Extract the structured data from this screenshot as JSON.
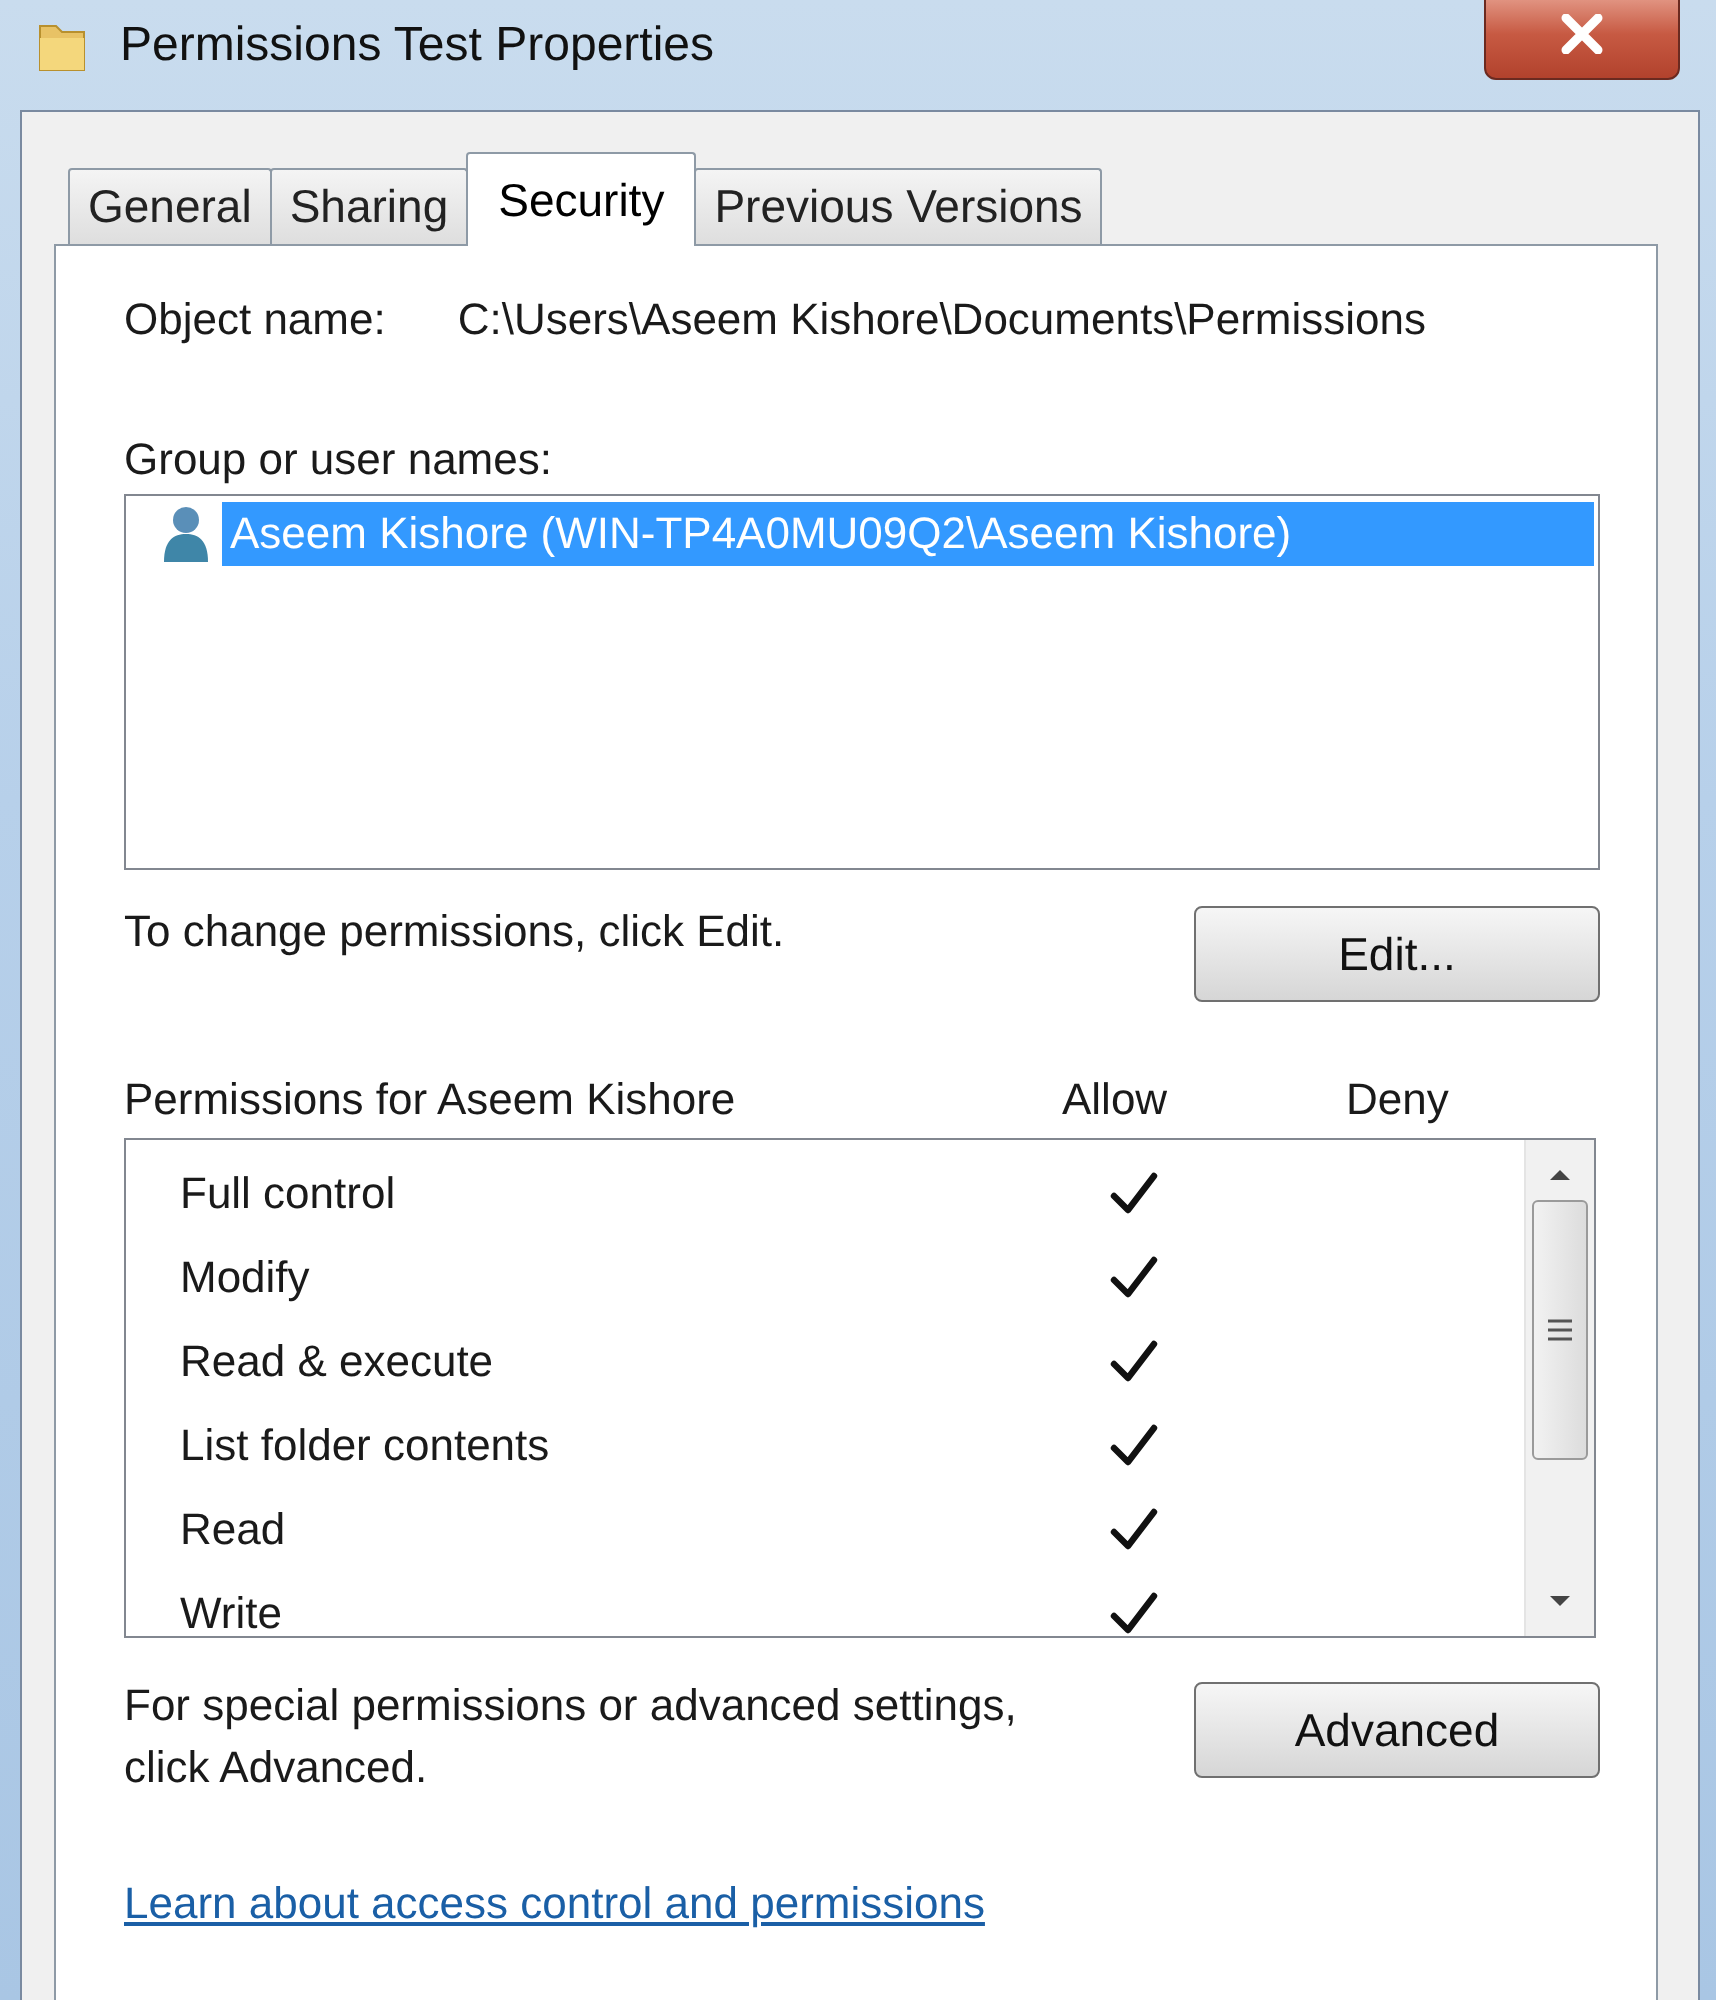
{
  "window": {
    "title": "Permissions Test Properties"
  },
  "tabs": [
    {
      "label": "General",
      "selected": false
    },
    {
      "label": "Sharing",
      "selected": false
    },
    {
      "label": "Security",
      "selected": true
    },
    {
      "label": "Previous Versions",
      "selected": false
    }
  ],
  "object_name": {
    "label": "Object name:",
    "value": "C:\\Users\\Aseem Kishore\\Documents\\Permissions"
  },
  "users": {
    "label": "Group or user names:",
    "items": [
      {
        "name": "Aseem Kishore (WIN-TP4A0MU09Q2\\Aseem Kishore)",
        "selected": true
      }
    ]
  },
  "edit_hint": "To change permissions, click Edit.",
  "edit_button": "Edit...",
  "permissions": {
    "title": "Permissions for Aseem Kishore",
    "allow_label": "Allow",
    "deny_label": "Deny",
    "entries": [
      {
        "name": "Full control",
        "allow": true,
        "deny": false
      },
      {
        "name": "Modify",
        "allow": true,
        "deny": false
      },
      {
        "name": "Read & execute",
        "allow": true,
        "deny": false
      },
      {
        "name": "List folder contents",
        "allow": true,
        "deny": false
      },
      {
        "name": "Read",
        "allow": true,
        "deny": false
      },
      {
        "name": "Write",
        "allow": true,
        "deny": false
      }
    ]
  },
  "advanced_hint": "For special permissions or advanced settings, click Advanced.",
  "advanced_button": "Advanced",
  "link": "Learn about access control and permissions"
}
